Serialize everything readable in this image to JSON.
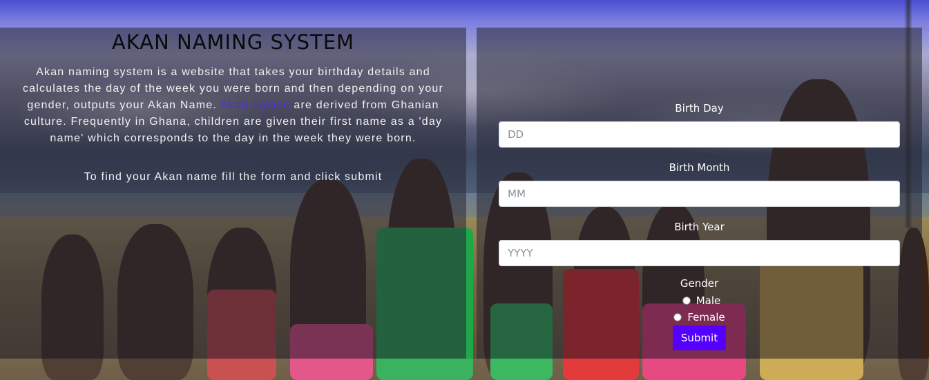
{
  "header": {
    "title": "AKAN NAMING SYSTEM"
  },
  "intro": {
    "text_before_link": "Akan naming system is a website that takes your birthday details and calculates the day of the week you were born and then depending on your gender, outputs your Akan Name. ",
    "link_text": "Akan names",
    "text_after_link": " are derived from Ghanian culture. Frequently in Ghana, children are given their first name as a 'day name' which corresponds to the day in the week they were born.",
    "instruction": "To find your Akan name fill the form and click submit"
  },
  "form": {
    "day": {
      "label": "Birth Day",
      "placeholder": "DD"
    },
    "month": {
      "label": "Birth Month",
      "placeholder": "MM"
    },
    "year": {
      "label": "Birth Year",
      "placeholder": "YYYY"
    },
    "gender": {
      "label": "Gender",
      "options": [
        "Male",
        "Female"
      ]
    },
    "submit_label": "Submit"
  },
  "colors": {
    "accent": "#5500ff",
    "link": "#4a2aff"
  }
}
